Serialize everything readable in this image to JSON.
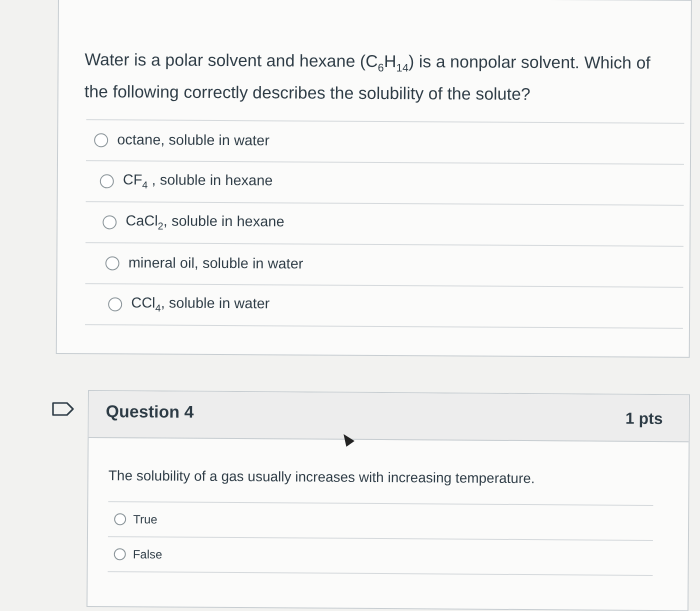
{
  "question3": {
    "text_before_formula": "Water is a polar solvent and hexane (C",
    "sub_6": "6",
    "text_mid_formula": "H",
    "sub_14": "14",
    "text_after_formula": ") is a nonpolar solvent. Which of the following correctly describes the solubility of the solute?",
    "answers": [
      {
        "label": "octane, soluble in water"
      },
      {
        "label_a": "CF",
        "sub": "4",
        "label_b": " , soluble in hexane"
      },
      {
        "label_a": "CaCl",
        "sub": "2",
        "label_b": ", soluble in hexane"
      },
      {
        "label": "mineral oil, soluble in water"
      },
      {
        "label_a": "CCl",
        "sub": "4",
        "label_b": ", soluble in water"
      }
    ]
  },
  "question4": {
    "title": "Question 4",
    "points": "1 pts",
    "text": "The solubility of a gas usually increases with increasing temperature.",
    "answers": [
      {
        "label": "True"
      },
      {
        "label": "False"
      }
    ]
  },
  "colors": {
    "text": "#2d3b45",
    "header_bg": "#ededed",
    "border": "#c7cdd1"
  }
}
